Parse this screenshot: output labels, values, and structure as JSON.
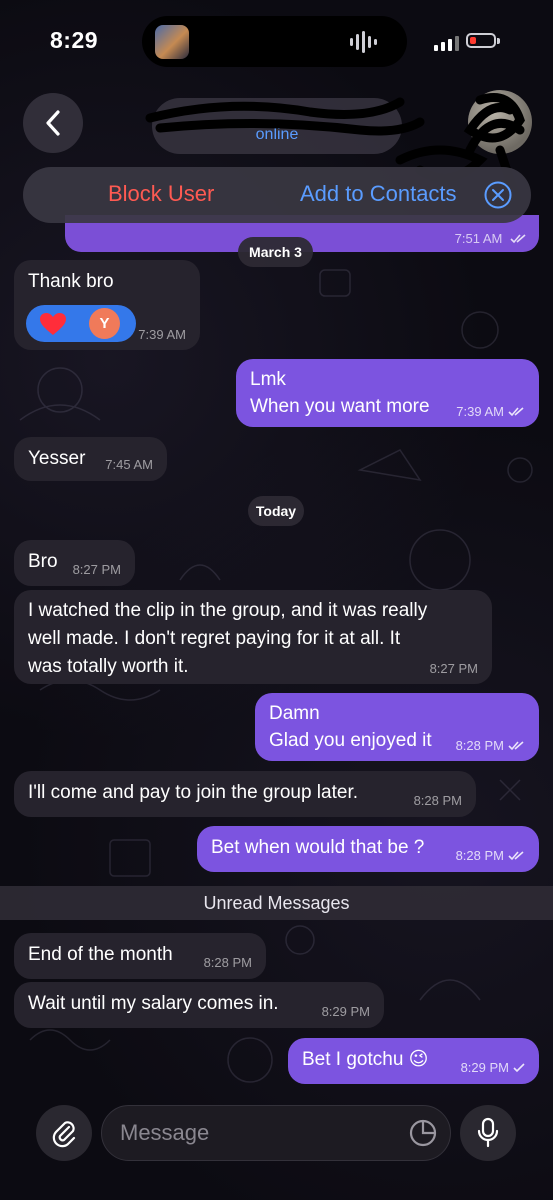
{
  "status_bar": {
    "time": "8:29"
  },
  "header": {
    "status": "online",
    "block_label": "Block User",
    "add_contacts_label": "Add to Contacts"
  },
  "previous_message": {
    "time": "7:51 AM"
  },
  "dates": {
    "march": "March 3",
    "today": "Today"
  },
  "messages": [
    {
      "dir": "in",
      "lines": [
        "Thank bro"
      ],
      "time": "7:39 AM",
      "reaction": {
        "emoji": "heart",
        "avatar_letter": "Y"
      }
    },
    {
      "dir": "out",
      "lines": [
        "Lmk",
        "When you want more"
      ],
      "time": "7:39 AM"
    },
    {
      "dir": "in",
      "lines": [
        "Yesser"
      ],
      "time": "7:45 AM"
    },
    {
      "dir": "in",
      "lines": [
        "Bro"
      ],
      "time": "8:27 PM"
    },
    {
      "dir": "in",
      "lines": [
        "I watched the clip in the group, and it was really",
        "well made. I don't regret paying for it at all. It",
        "was totally worth it."
      ],
      "time": "8:27 PM"
    },
    {
      "dir": "out",
      "lines": [
        "Damn",
        "Glad you enjoyed it"
      ],
      "time": "8:28 PM"
    },
    {
      "dir": "in",
      "lines": [
        "I'll come and pay to join the group later."
      ],
      "time": "8:28 PM"
    },
    {
      "dir": "out",
      "lines": [
        "Bet when would that be ?"
      ],
      "time": "8:28 PM"
    },
    {
      "dir": "in",
      "lines": [
        "End of the month"
      ],
      "time": "8:28 PM"
    },
    {
      "dir": "in",
      "lines": [
        "Wait until my salary comes in."
      ],
      "time": "8:29 PM"
    },
    {
      "dir": "out",
      "lines": [
        "Bet I gotchu 😉"
      ],
      "time": "8:29 PM"
    }
  ],
  "unread_label": "Unread Messages",
  "composer": {
    "placeholder": "Message"
  },
  "colors": {
    "accent_blue": "#5a9cff",
    "block_red": "#ff5a52",
    "outgoing_bubble": "#7c54e0",
    "incoming_bubble": "#26232d"
  },
  "icons": [
    "back-chevron-icon",
    "close-circle-icon",
    "attach-paperclip-icon",
    "sticker-icon",
    "microphone-icon",
    "double-check-icon",
    "heart-icon"
  ]
}
